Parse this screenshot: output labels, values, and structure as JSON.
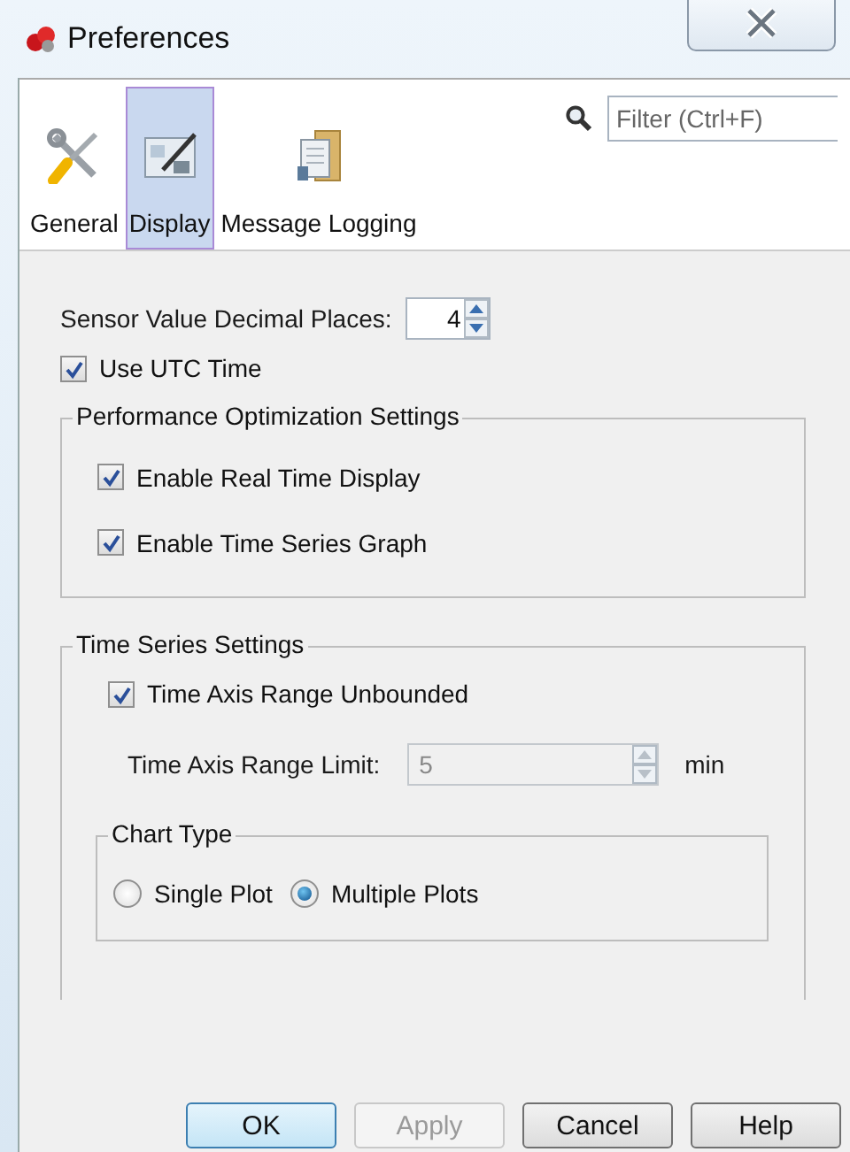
{
  "window": {
    "title": "Preferences"
  },
  "categories": [
    {
      "label": "General",
      "selected": false,
      "kind": "tools"
    },
    {
      "label": "Display",
      "selected": true,
      "kind": "display"
    },
    {
      "label": "Message Logging",
      "selected": false,
      "kind": "folder"
    }
  ],
  "filter": {
    "placeholder": "Filter (Ctrl+F)"
  },
  "decimal_places": {
    "label": "Sensor Value Decimal Places:",
    "value": "4"
  },
  "use_utc": {
    "label": "Use UTC Time",
    "checked": true
  },
  "performance": {
    "title": "Performance Optimization Settings",
    "options": [
      {
        "label": "Enable Real Time Display",
        "checked": true
      },
      {
        "label": "Enable Time Series Graph",
        "checked": true
      }
    ]
  },
  "time_series": {
    "title": "Time Series Settings",
    "unbounded": {
      "label": "Time Axis Range Unbounded",
      "checked": true
    },
    "range_limit": {
      "label": "Time Axis Range Limit:",
      "value": "5",
      "unit": "min",
      "disabled": true
    },
    "chart_type": {
      "title": "Chart Type",
      "options": [
        {
          "label": "Single Plot",
          "selected": false
        },
        {
          "label": "Multiple Plots",
          "selected": true
        }
      ]
    }
  },
  "buttons": [
    {
      "label": "OK",
      "default": true,
      "disabled": false
    },
    {
      "label": "Apply",
      "default": false,
      "disabled": true
    },
    {
      "label": "Cancel",
      "default": false,
      "disabled": false
    },
    {
      "label": "Help",
      "default": false,
      "disabled": false
    }
  ]
}
